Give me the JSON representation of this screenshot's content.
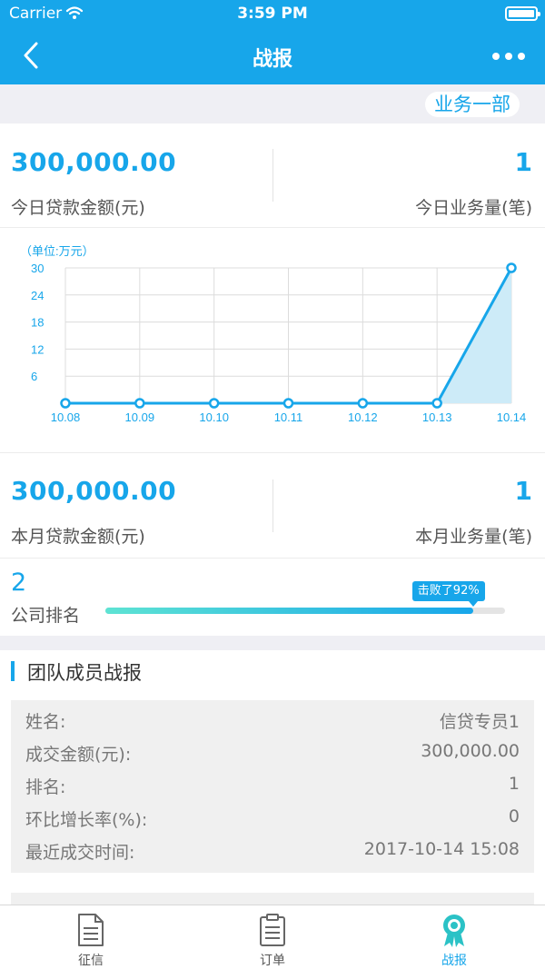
{
  "status_bar": {
    "carrier": "Carrier",
    "time": "3:59 PM"
  },
  "nav": {
    "title": "战报"
  },
  "department": "业务一部",
  "today": {
    "loan_amount": "300,000.00",
    "loan_amount_label": "今日贷款金额(元)",
    "business_count": "1",
    "business_count_label": "今日业务量(笔)"
  },
  "chart_data": {
    "type": "area",
    "unit_label": "（单位:万元）",
    "categories": [
      "10.08",
      "10.09",
      "10.10",
      "10.11",
      "10.12",
      "10.13",
      "10.14"
    ],
    "values": [
      0,
      0,
      0,
      0,
      0,
      0,
      30
    ],
    "y_ticks": [
      "30",
      "24",
      "18",
      "12",
      "6"
    ],
    "ylim": [
      0,
      30
    ],
    "grid": true,
    "line_color": "#17a6ea",
    "fill_color": "#cdebf8"
  },
  "month": {
    "loan_amount": "300,000.00",
    "loan_amount_label": "本月贷款金额(元)",
    "business_count": "1",
    "business_count_label": "本月业务量(笔)"
  },
  "ranking": {
    "value": "2",
    "label": "公司排名",
    "beat_text": "击败了92%",
    "beat_percent": 92
  },
  "team": {
    "title": "团队成员战报",
    "members": [
      {
        "name_label": "姓名:",
        "name": "信贷专员1",
        "amount_label": "成交金额(元):",
        "amount": "300,000.00",
        "rank_label": "排名:",
        "rank": "1",
        "growth_label": "环比增长率(%):",
        "growth": "0",
        "recent_label": "最近成交时间:",
        "recent": "2017-10-14 15:08"
      }
    ]
  },
  "tabbar": {
    "items": [
      {
        "label": "征信",
        "icon": "document-icon"
      },
      {
        "label": "订单",
        "icon": "clipboard-icon"
      },
      {
        "label": "战报",
        "icon": "award-icon"
      }
    ],
    "active": 2
  },
  "colors": {
    "accent": "#17a6ea",
    "background": "#efeff4"
  }
}
